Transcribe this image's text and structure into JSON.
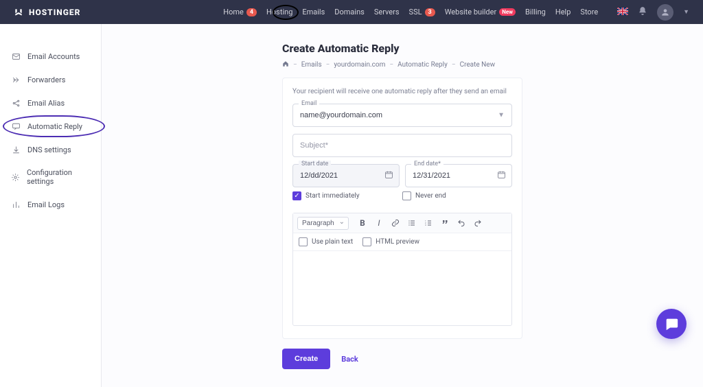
{
  "topbar": {
    "brand": "HOSTINGER",
    "nav": [
      {
        "label": "Home",
        "badge": "4"
      },
      {
        "label": "Hosting"
      },
      {
        "label": "Emails"
      },
      {
        "label": "Domains"
      },
      {
        "label": "Servers"
      },
      {
        "label": "SSL",
        "badge": "3"
      },
      {
        "label": "Website builder",
        "badge_text": "New"
      },
      {
        "label": "Billing"
      },
      {
        "label": "Help"
      },
      {
        "label": "Store"
      }
    ]
  },
  "sidebar": {
    "items": [
      {
        "label": "Email Accounts",
        "icon": "mail-icon"
      },
      {
        "label": "Forwarders",
        "icon": "forward-icon"
      },
      {
        "label": "Email Alias",
        "icon": "share-icon"
      },
      {
        "label": "Automatic Reply",
        "icon": "chat-icon",
        "active": true
      },
      {
        "label": "DNS settings",
        "icon": "download-icon"
      },
      {
        "label": "Configuration settings",
        "icon": "gear-icon"
      },
      {
        "label": "Email Logs",
        "icon": "stats-icon"
      }
    ]
  },
  "page": {
    "title": "Create Automatic Reply",
    "breadcrumb": [
      "Emails",
      "yourdomain.com",
      "Automatic Reply",
      "Create New"
    ]
  },
  "form": {
    "hint": "Your recipient will receive one automatic reply after they send an email",
    "email_label": "Email",
    "email_value": "name@yourdomain.com",
    "subject_placeholder": "Subject*",
    "start_label": "Start date",
    "start_value": "12/dd/2021",
    "end_label": "End date*",
    "end_value": "12/31/2021",
    "start_immediately": "Start immediately",
    "never_end": "Never end",
    "checks": {
      "start_immediately": true,
      "never_end": false
    },
    "editor": {
      "format": "Paragraph",
      "use_plain": "Use plain text",
      "html_preview": "HTML preview"
    },
    "create_label": "Create",
    "back_label": "Back"
  }
}
